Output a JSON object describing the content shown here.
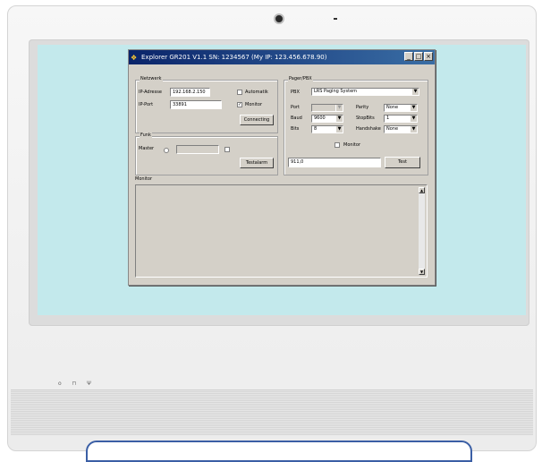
{
  "device": {
    "indicators": "o  ⊓  Ψ"
  },
  "window": {
    "title": "Explorer GR201 V1.1  SN: 1234567 (My IP: 123.456.678.90)",
    "controls": {
      "minimize": "_",
      "maximize": "□",
      "close": "×"
    }
  },
  "netzwerk": {
    "legend": "Netzwerk",
    "ip_label": "IP-Adresse",
    "ip_value": "192.168.2.150",
    "port_label": "IP-Port",
    "port_value": "33891",
    "automatik_label": "Automatik",
    "automatik_checked": false,
    "monitor_label": "Monitor",
    "monitor_checked": true,
    "connect_button": "Connecting"
  },
  "funk": {
    "legend": "Funk",
    "master_label": "Master",
    "test_button": "Testalarm"
  },
  "pager": {
    "legend": "Pager/PBX",
    "pbx_label": "PBX",
    "pbx_value": "LRS Paging System",
    "port_label": "Port",
    "port_value": "",
    "baud_label": "Baud",
    "baud_value": "9600",
    "bits_label": "Bits",
    "bits_value": "8",
    "parity_label": "Parity",
    "parity_value": "None",
    "stopbits_label": "StopBits",
    "stopbits_value": "1",
    "handshake_label": "Handshake",
    "handshake_value": "None",
    "monitor_label": "Monitor",
    "monitor_checked": false,
    "test_input": "911,0",
    "test_button": "Test"
  },
  "monitor_panel": {
    "label": "Monitor"
  }
}
